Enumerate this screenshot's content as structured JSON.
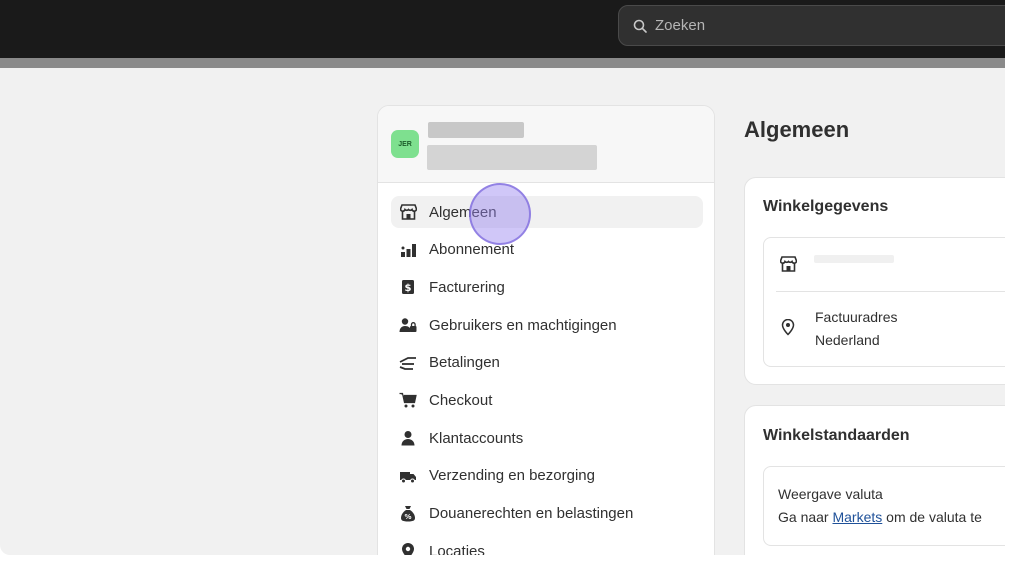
{
  "topbar": {
    "search_placeholder": "Zoeken"
  },
  "store": {
    "avatar_initials": "JER"
  },
  "nav": {
    "items": [
      {
        "label": "Algemeen",
        "icon": "store-icon",
        "active": true
      },
      {
        "label": "Abonnement",
        "icon": "plan-icon"
      },
      {
        "label": "Facturering",
        "icon": "billing-icon"
      },
      {
        "label": "Gebruikers en machtigingen",
        "icon": "users-icon"
      },
      {
        "label": "Betalingen",
        "icon": "payments-icon"
      },
      {
        "label": "Checkout",
        "icon": "cart-icon"
      },
      {
        "label": "Klantaccounts",
        "icon": "person-icon"
      },
      {
        "label": "Verzending en bezorging",
        "icon": "truck-icon"
      },
      {
        "label": "Douanerechten en belastingen",
        "icon": "tax-icon"
      },
      {
        "label": "Locaties",
        "icon": "location-icon"
      }
    ]
  },
  "main": {
    "title": "Algemeen",
    "store_details": {
      "title": "Winkelgegevens",
      "billing_address_label": "Factuuradres",
      "billing_address_value": "Nederland"
    },
    "store_defaults": {
      "title": "Winkelstandaarden",
      "currency_label": "Weergave valuta",
      "currency_text_before": "Ga naar ",
      "currency_link": "Markets",
      "currency_text_after": " om de valuta te"
    }
  },
  "colors": {
    "topbar": "#1a1a1a",
    "background": "#f1f1f1",
    "avatar": "#7ee08f",
    "link": "#1f5199",
    "cursor": "#9682f0"
  }
}
